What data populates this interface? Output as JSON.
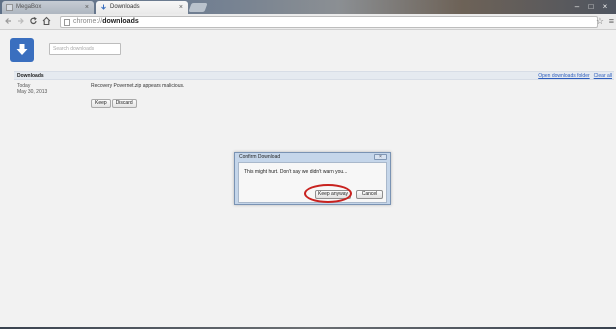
{
  "tabs": [
    {
      "label": "MegaBox",
      "active": false
    },
    {
      "label": "Downloads",
      "active": true
    }
  ],
  "window_controls": [
    "–",
    "□",
    "×"
  ],
  "toolbar": {
    "back_icon": "back-arrow-icon",
    "forward_icon": "forward-arrow-icon",
    "reload_icon": "reload-icon",
    "home_icon": "home-icon",
    "url_scheme": "chrome://",
    "url_host": "downloads",
    "star": "☆",
    "menu": "≡"
  },
  "downloads": {
    "icon": "download-arrow-icon",
    "search_placeholder": "Search downloads",
    "section_title": "Downloads",
    "open_folder_link": "Open downloads folder",
    "clear_all_link": "Clear all",
    "date_group": "Today",
    "date_full": "May 30, 2013",
    "item_message": "Recovery Povernet.zip appears malicious.",
    "keep_label": "Keep",
    "discard_label": "Discard"
  },
  "dialog": {
    "title": "Confirm Download",
    "message": "This might hurt. Don't say we didn't warn you...",
    "keep_anyway_label": "Keep anyway",
    "cancel_label": "Cancel",
    "highlight_color": "#c8221f"
  },
  "colors": {
    "accent_blue": "#3a6fbf",
    "link": "#2d5dbd",
    "dialog_frame": "#c5d6ea"
  }
}
